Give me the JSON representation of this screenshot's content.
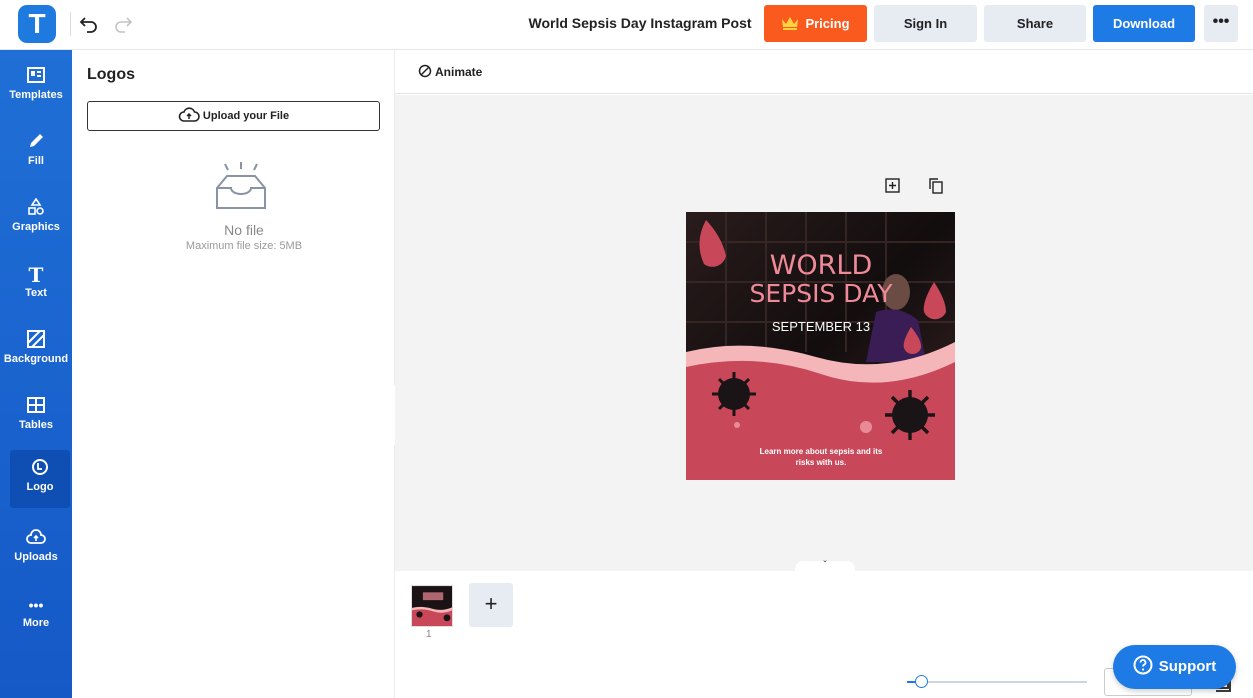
{
  "app": {
    "logo_letter": "T"
  },
  "header": {
    "document_title": "World Sepsis Day Instagram Post",
    "pricing_label": "Pricing",
    "signin_label": "Sign In",
    "share_label": "Share",
    "download_label": "Download",
    "more_label": "•••"
  },
  "sidebar": {
    "items": [
      {
        "label": "Templates",
        "icon": "templates-icon"
      },
      {
        "label": "Fill",
        "icon": "pencil-icon"
      },
      {
        "label": "Graphics",
        "icon": "shapes-icon"
      },
      {
        "label": "Text",
        "icon": "text-icon"
      },
      {
        "label": "Background",
        "icon": "background-icon"
      },
      {
        "label": "Tables",
        "icon": "table-icon"
      },
      {
        "label": "Logo",
        "icon": "logo-icon"
      },
      {
        "label": "Uploads",
        "icon": "cloud-upload-icon"
      },
      {
        "label": "More",
        "icon": "more-icon"
      }
    ],
    "active": "Logo"
  },
  "panel": {
    "title": "Logos",
    "upload_label": "Upload your File",
    "empty_title": "No file",
    "empty_subtitle": "Maximum file size: 5MB"
  },
  "toolbar": {
    "animate_label": "Animate"
  },
  "design": {
    "title_line1": "WORLD",
    "title_line2": "SEPSIS DAY",
    "date": "SEPTEMBER 13",
    "tagline_line1": "Learn more about sepsis and its",
    "tagline_line2": "risks with us.",
    "colors": {
      "primary": "#c8485a",
      "light_pink": "#f4b6b8",
      "dark": "#1a1416"
    }
  },
  "pages": {
    "current_page": "1",
    "add_label": "+"
  },
  "support": {
    "label": "Support"
  },
  "colors": {
    "accent": "#1e7be6",
    "pricing": "#fa5a1e",
    "rail": "#1f6fd6"
  }
}
